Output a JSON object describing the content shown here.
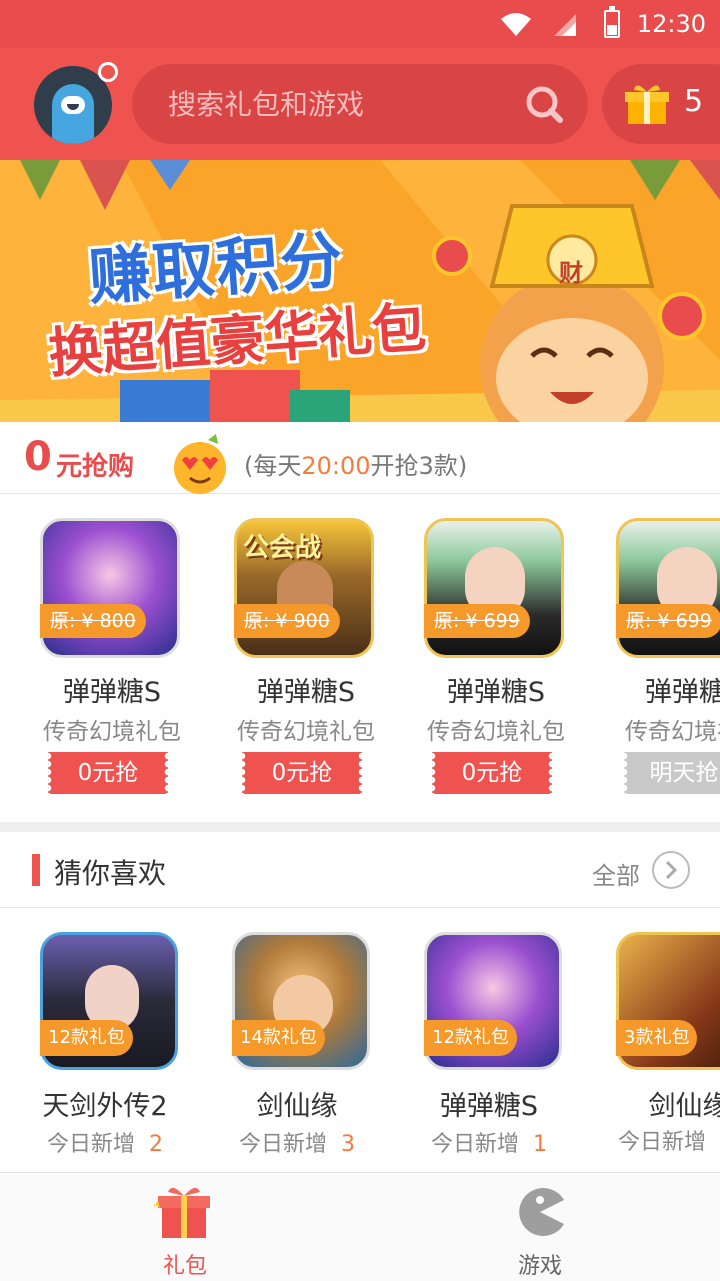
{
  "status_bar": {
    "time": "12:30"
  },
  "header": {
    "search_placeholder": "搜索礼包和游戏",
    "gift_count": "5"
  },
  "banner": {
    "line1": "赚取积分",
    "line2": "换超值豪华礼包",
    "badge": "财"
  },
  "flash_sale": {
    "zero": "0",
    "title": "元抢购",
    "note_prefix": "(每天",
    "note_time": "20:00",
    "note_suffix": "开抢3款)",
    "items": [
      {
        "original_price": "原: ¥ 800",
        "name": "弹弹糖S",
        "subtitle": "传奇幻境礼包",
        "button": "0元抢",
        "icon": "candy-girl-icon"
      },
      {
        "original_price": "原: ¥ 900",
        "name": "弹弹糖S",
        "subtitle": "传奇幻境礼包",
        "button": "0元抢",
        "icon": "monk-icon"
      },
      {
        "original_price": "原: ¥ 699",
        "name": "弹弹糖S",
        "subtitle": "传奇幻境礼包",
        "button": "0元抢",
        "icon": "glasses-girl-icon"
      },
      {
        "original_price": "原: ¥ 699",
        "name": "弹弹糖S",
        "subtitle": "传奇幻境礼包",
        "button": "明天抢",
        "icon": "glasses-girl-icon"
      }
    ],
    "logo_text": "公会战"
  },
  "recommend": {
    "title": "猜你喜欢",
    "all_label": "全部",
    "items": [
      {
        "badge": "12款礼包",
        "name": "天剑外传2",
        "subtitle": "今日新增",
        "count": "2"
      },
      {
        "badge": "14款礼包",
        "name": "剑仙缘",
        "subtitle": "今日新增",
        "count": "3"
      },
      {
        "badge": "12款礼包",
        "name": "弹弹糖S",
        "subtitle": "今日新增",
        "count": "1"
      },
      {
        "badge": "3款礼包",
        "name": "剑仙缘",
        "subtitle": "今日新增",
        "count": ""
      }
    ]
  },
  "bottom_nav": {
    "items": [
      {
        "label": "礼包",
        "active": true
      },
      {
        "label": "游戏",
        "active": false
      }
    ]
  },
  "colors": {
    "primary": "#ef5350",
    "accent": "#f59a2a",
    "highlight": "#f57c3a"
  }
}
